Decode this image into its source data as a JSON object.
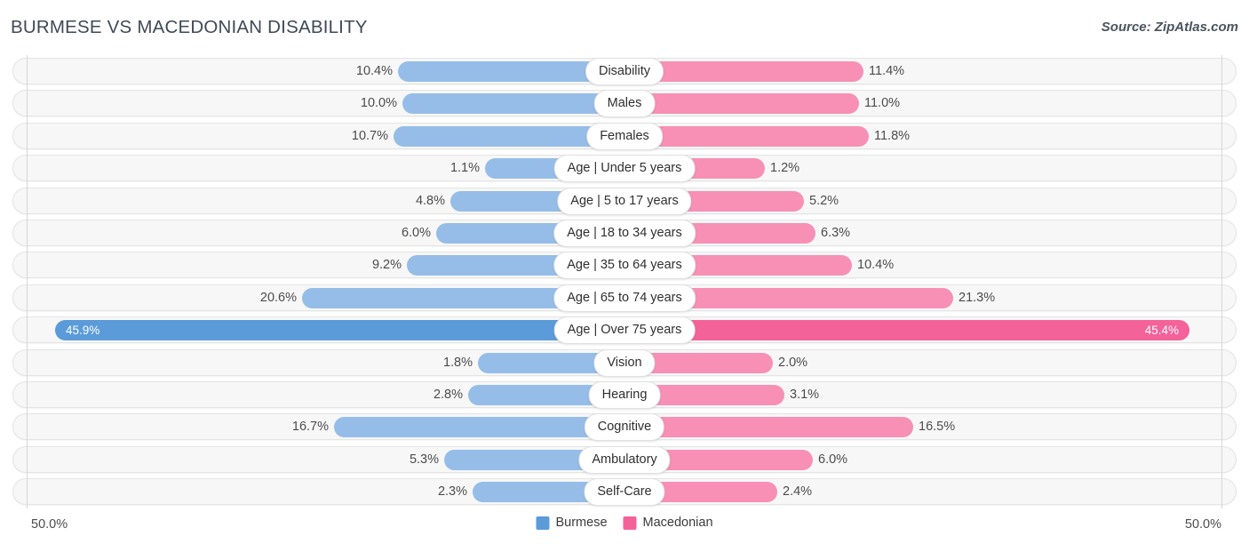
{
  "header": {
    "title": "BURMESE VS MACEDONIAN DISABILITY",
    "source": "Source: ZipAtlas.com"
  },
  "axis": {
    "left_tick": "50.0%",
    "right_tick": "50.0%"
  },
  "legend": {
    "items": [
      {
        "label": "Burmese",
        "color": "#5b9bd9"
      },
      {
        "label": "Macedonian",
        "color": "#f4629a"
      }
    ]
  },
  "chart_data": {
    "type": "bar",
    "subtype": "diverging-bidirectional",
    "title": "BURMESE VS MACEDONIAN DISABILITY",
    "xlabel": "",
    "ylabel": "",
    "xlim": [
      50.0,
      50.0
    ],
    "axis_left_label": "50.0%",
    "axis_right_label": "50.0%",
    "grid": false,
    "legend_position": "bottom-center",
    "series": [
      {
        "name": "Burmese",
        "color": "#5b9bd9",
        "side": "left",
        "values": [
          10.4,
          10.0,
          10.7,
          1.1,
          4.8,
          6.0,
          9.2,
          20.6,
          45.9,
          1.8,
          2.8,
          16.7,
          5.3,
          2.3
        ]
      },
      {
        "name": "Macedonian",
        "color": "#f4629a",
        "side": "right",
        "values": [
          11.4,
          11.0,
          11.8,
          1.2,
          5.2,
          6.3,
          10.4,
          21.3,
          45.4,
          2.0,
          3.1,
          16.5,
          6.0,
          2.4
        ]
      }
    ],
    "categories": [
      "Disability",
      "Males",
      "Females",
      "Age | Under 5 years",
      "Age | 5 to 17 years",
      "Age | 18 to 34 years",
      "Age | 35 to 64 years",
      "Age | 65 to 74 years",
      "Age | Over 75 years",
      "Vision",
      "Hearing",
      "Cognitive",
      "Ambulatory",
      "Self-Care"
    ],
    "rows": [
      {
        "label": "Disability",
        "left_value": "10.4%",
        "right_value": "11.4%",
        "left_frac": 0.398,
        "right_frac": 0.42,
        "highlight": false
      },
      {
        "label": "Males",
        "left_value": "10.0%",
        "right_value": "11.0%",
        "left_frac": 0.39,
        "right_frac": 0.412,
        "highlight": false
      },
      {
        "label": "Females",
        "left_value": "10.7%",
        "right_value": "11.8%",
        "left_frac": 0.406,
        "right_frac": 0.429,
        "highlight": false
      },
      {
        "label": "Age | Under 5 years",
        "left_value": "1.1%",
        "right_value": "1.2%",
        "left_frac": 0.245,
        "right_frac": 0.247,
        "highlight": false
      },
      {
        "label": "Age | 5 to 17 years",
        "left_value": "4.8%",
        "right_value": "5.2%",
        "left_frac": 0.306,
        "right_frac": 0.315,
        "highlight": false
      },
      {
        "label": "Age | 18 to 34 years",
        "left_value": "6.0%",
        "right_value": "6.3%",
        "left_frac": 0.33,
        "right_frac": 0.336,
        "highlight": false
      },
      {
        "label": "Age | 35 to 64 years",
        "left_value": "9.2%",
        "right_value": "10.4%",
        "left_frac": 0.382,
        "right_frac": 0.4,
        "highlight": false
      },
      {
        "label": "Age | 65 to 74 years",
        "left_value": "20.6%",
        "right_value": "21.3%",
        "left_frac": 0.567,
        "right_frac": 0.578,
        "highlight": false
      },
      {
        "label": "Age | Over 75 years",
        "left_value": "45.9%",
        "right_value": "45.4%",
        "left_frac": 1.0,
        "right_frac": 0.992,
        "highlight": true
      },
      {
        "label": "Vision",
        "left_value": "1.8%",
        "right_value": "2.0%",
        "left_frac": 0.257,
        "right_frac": 0.261,
        "highlight": false
      },
      {
        "label": "Hearing",
        "left_value": "2.8%",
        "right_value": "3.1%",
        "left_frac": 0.275,
        "right_frac": 0.281,
        "highlight": false
      },
      {
        "label": "Cognitive",
        "left_value": "16.7%",
        "right_value": "16.5%",
        "left_frac": 0.51,
        "right_frac": 0.507,
        "highlight": false
      },
      {
        "label": "Ambulatory",
        "left_value": "5.3%",
        "right_value": "6.0%",
        "left_frac": 0.316,
        "right_frac": 0.33,
        "highlight": false
      },
      {
        "label": "Self-Care",
        "left_value": "2.3%",
        "right_value": "2.4%",
        "left_frac": 0.266,
        "right_frac": 0.268,
        "highlight": false
      }
    ]
  }
}
